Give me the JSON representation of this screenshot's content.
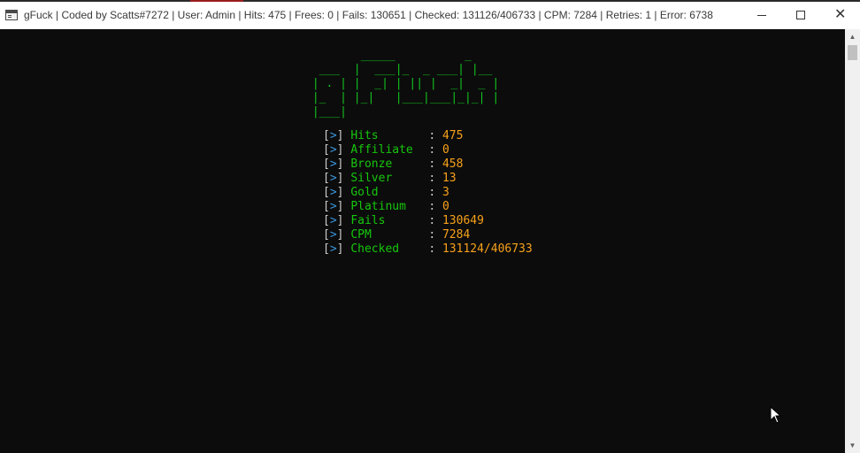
{
  "window": {
    "title": "gFuck | Coded by Scatts#7272 | User: Admin | Hits: 475 | Frees: 0 | Fails: 130651 | Checked: 131126/406733 | CPM: 7284 | Retries: 1 | Error: 6738",
    "icon": "console-app-icon",
    "controls": {
      "minimize_icon": "minimize-icon",
      "maximize_icon": "maximize-icon",
      "close_glyph": "✕"
    }
  },
  "console": {
    "logo_ascii": "        _____          _    \n  ___  |  ___|_  _ ___| |__ \n | . | |  _| | || |  _|  _ |\n |_  | |_|   |___|___|_|_| |\n |___|                      ",
    "prefix_open": "[",
    "prefix_arrow": ">",
    "prefix_close": "]",
    "separator": ": ",
    "stats": [
      {
        "label": "Hits",
        "value": "475"
      },
      {
        "label": "Affiliate",
        "value": "0"
      },
      {
        "label": "Bronze",
        "value": "458"
      },
      {
        "label": "Silver",
        "value": "13"
      },
      {
        "label": "Gold",
        "value": "3"
      },
      {
        "label": "Platinum",
        "value": "0"
      },
      {
        "label": "Fails",
        "value": "130649"
      },
      {
        "label": "CPM",
        "value": "7284"
      },
      {
        "label": "Checked",
        "value": "131124/406733"
      }
    ]
  },
  "scrollbar": {
    "up_glyph": "▲",
    "down_glyph": "▼"
  },
  "colors": {
    "background": "#0c0c0c",
    "logo": "#12c41f",
    "label": "#16c60c",
    "value": "#f7a11a",
    "arrow": "#3a96dd",
    "bracket": "#cccccc"
  }
}
